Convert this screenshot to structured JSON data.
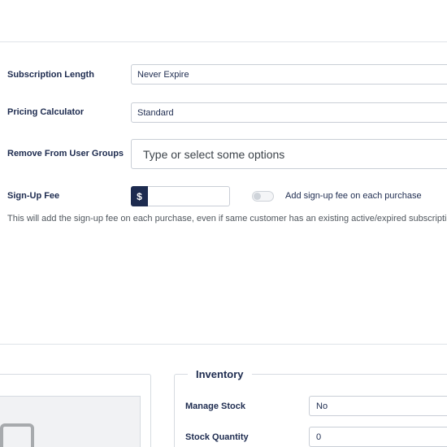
{
  "subscription": {
    "length_label": "Subscription Length",
    "length_value": "Never Expire",
    "pricing_label": "Pricing Calculator",
    "pricing_value": "Standard",
    "groups_label": "Remove From User Groups",
    "groups_placeholder": "Type or select some options",
    "fee_label": "Sign-Up Fee",
    "fee_currency": "$",
    "fee_value": "",
    "fee_toggle_label": "Add sign-up fee on each purchase",
    "fee_toggle_on": false,
    "fee_help": "This will add the sign-up fee on each purchase, even if same customer has an existing active/expired subscription"
  },
  "inventory": {
    "legend": "Inventory",
    "manage_stock_label": "Manage Stock",
    "manage_stock_value": "No",
    "stock_qty_label": "Stock Quantity",
    "stock_qty_value": "0"
  }
}
